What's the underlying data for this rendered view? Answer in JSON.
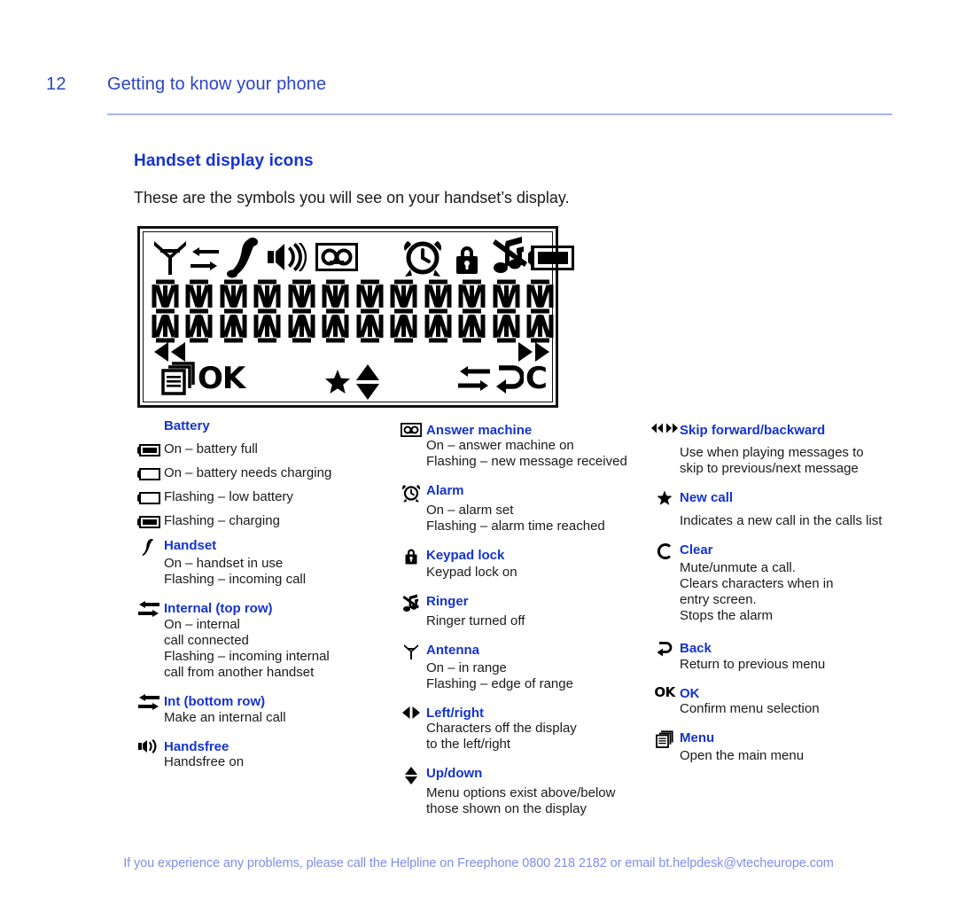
{
  "header": {
    "page_number": "12",
    "title": "Getting to know your phone"
  },
  "section": {
    "heading": "Handset display icons",
    "intro": "These are the symbols you will see on your handset’s display."
  },
  "lcd": {
    "top_icons": [
      "antenna-icon",
      "internal-exchange-icon",
      "handset-icon",
      "speaker-icon",
      "answer-machine-icon",
      "alarm-clock-icon",
      "keypad-lock-icon",
      "ringer-off-icon",
      "battery-icon"
    ],
    "segment_char_count": 12,
    "arrow_left": "skip-backward-icon",
    "arrow_right": "skip-forward-icon",
    "bottom_icons": [
      "menu-icon",
      "ok-label",
      "star-icon",
      "up-down-icon",
      "internal-exchange-icon",
      "back-icon",
      "clear-icon"
    ],
    "ok_label": "OK",
    "clear_label": "C"
  },
  "colors": {
    "heading_blue": "#1433d0",
    "header_blue": "#2b44c7",
    "rule_blue": "#a7b4f2",
    "footer_blue": "#7f8fe8",
    "body_text": "#1a1a1a"
  },
  "legend": {
    "left_column": {
      "battery_group": {
        "title": "Battery",
        "rows": [
          {
            "icon": "battery-full-icon",
            "text": "On – battery full"
          },
          {
            "icon": "battery-empty-icon",
            "text": "On – battery needs charging"
          },
          {
            "icon": "battery-empty-icon",
            "text": "Flashing – low battery"
          },
          {
            "icon": "battery-full-icon",
            "text": "Flashing – charging"
          }
        ]
      },
      "entries": [
        {
          "icon": "handset-icon",
          "title": "Handset",
          "lines": [
            "On – handset in use",
            "Flashing – incoming call"
          ]
        },
        {
          "icon": "internal-exchange-icon",
          "title": "Internal (top row)",
          "lines": [
            "On – internal",
            "call connected",
            "Flashing – incoming internal",
            "call from another handset"
          ]
        },
        {
          "icon": "internal-exchange-icon",
          "title": "Int (bottom row)",
          "lines": [
            "Make an internal call"
          ]
        },
        {
          "icon": "handsfree-icon",
          "title": "Handsfree",
          "lines": [
            "Handsfree on"
          ]
        }
      ]
    },
    "middle_column": {
      "entries": [
        {
          "icon": "answer-machine-icon",
          "title": "Answer machine",
          "lines": [
            "On – answer machine on",
            "Flashing – new message received"
          ]
        },
        {
          "icon": "alarm-clock-icon",
          "title": "Alarm",
          "lines": [
            "On – alarm set",
            "Flashing – alarm time reached"
          ]
        },
        {
          "icon": "keypad-lock-icon",
          "title": "Keypad lock",
          "lines": [
            "Keypad lock on"
          ]
        },
        {
          "icon": "ringer-off-icon",
          "title": "Ringer",
          "lines": [
            "Ringer turned off"
          ]
        },
        {
          "icon": "antenna-icon",
          "title": "Antenna",
          "lines": [
            "On – in range",
            "Flashing – edge of range"
          ]
        },
        {
          "icon": "left-right-icon",
          "title": "Left/right",
          "lines": [
            "Characters off the display",
            "to the left/right"
          ]
        },
        {
          "icon": "up-down-icon",
          "title": "Up/down",
          "lines": [
            "Menu options exist above/below",
            "those shown on the display"
          ]
        }
      ]
    },
    "right_column": {
      "entries": [
        {
          "icon": "skip-forward-backward-icon",
          "title": "Skip forward/backward",
          "lines": [
            "Use when playing messages to",
            "skip to previous/next message"
          ]
        },
        {
          "icon": "star-icon",
          "title": "New call",
          "lines": [
            "Indicates a new call in the calls list"
          ]
        },
        {
          "icon": "clear-icon",
          "title": "Clear",
          "lines": [
            "Mute/unmute a call.",
            "Clears characters when in",
            "entry screen.",
            "Stops the alarm"
          ]
        },
        {
          "icon": "back-icon",
          "title": "Back",
          "lines": [
            "Return to previous menu"
          ]
        },
        {
          "icon": "ok-icon",
          "title": "OK",
          "lines": [
            "Confirm menu selection"
          ]
        },
        {
          "icon": "menu-icon",
          "title": "Menu",
          "lines": [
            "Open the main menu"
          ]
        }
      ]
    }
  },
  "footer": {
    "text": "If you experience any problems, please call the Helpline on Freephone 0800 218 2182 or email bt.helpdesk@vtecheurope.com"
  }
}
